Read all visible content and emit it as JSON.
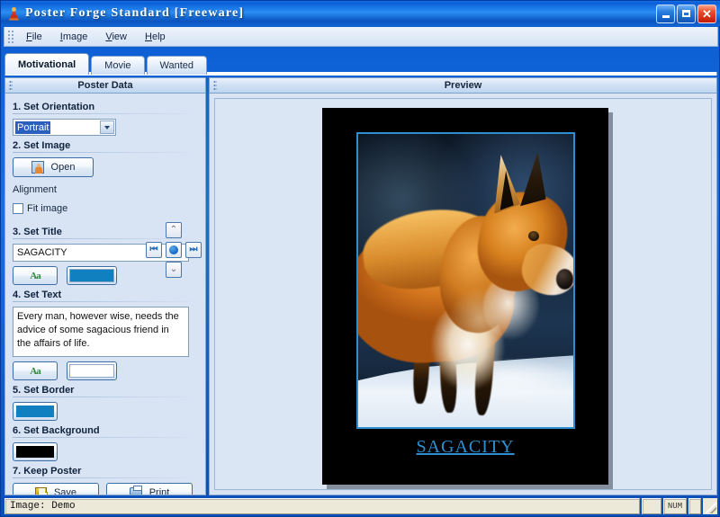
{
  "window": {
    "title": "Poster Forge Standard [Freeware]",
    "icon": "app-icon",
    "controls": {
      "minimize": "minimize-button",
      "maximize": "maximize-button",
      "close_glyph": "✕"
    }
  },
  "menu": {
    "items": [
      {
        "label": "File",
        "accel": "F"
      },
      {
        "label": "Image",
        "accel": "I"
      },
      {
        "label": "View",
        "accel": "V"
      },
      {
        "label": "Help",
        "accel": "H"
      }
    ]
  },
  "tabs": [
    {
      "label": "Motivational",
      "active": true
    },
    {
      "label": "Movie",
      "active": false
    },
    {
      "label": "Wanted",
      "active": false
    }
  ],
  "panels": {
    "left_title": "Poster Data",
    "right_title": "Preview"
  },
  "form": {
    "orientation": {
      "label": "1. Set Orientation",
      "value": "Portrait"
    },
    "image": {
      "label": "2. Set Image",
      "open_label": "Open",
      "alignment_label": "Alignment",
      "fit_image_label": "Fit image",
      "fit_image_checked": false,
      "align_buttons": {
        "up": "⤓",
        "left": "⏪",
        "center": "●",
        "right": "⏩",
        "down": "⤓"
      }
    },
    "title": {
      "label": "3. Set Title",
      "value": "SAGACITY",
      "font_glyph": "Aa",
      "color": "#1080c0"
    },
    "text": {
      "label": "4. Set Text",
      "value": "Every man, however wise, needs the advice of some sagacious friend in the affairs of life.",
      "font_glyph": "Aa",
      "color": "#ffffff"
    },
    "border": {
      "label": "5. Set Border",
      "color": "#1080c0"
    },
    "background": {
      "label": "6. Set Background",
      "color": "#000000"
    },
    "keep": {
      "label": "7. Keep Poster",
      "save_label": "Save",
      "print_label": "Print"
    }
  },
  "preview": {
    "poster_title": "SAGACITY",
    "poster_background": "#000000",
    "poster_border_color": "#2d8fd0",
    "image_subject": "red fox standing in snow"
  },
  "statusbar": {
    "message": "Image: Demo",
    "num_indicator": "NUM"
  }
}
